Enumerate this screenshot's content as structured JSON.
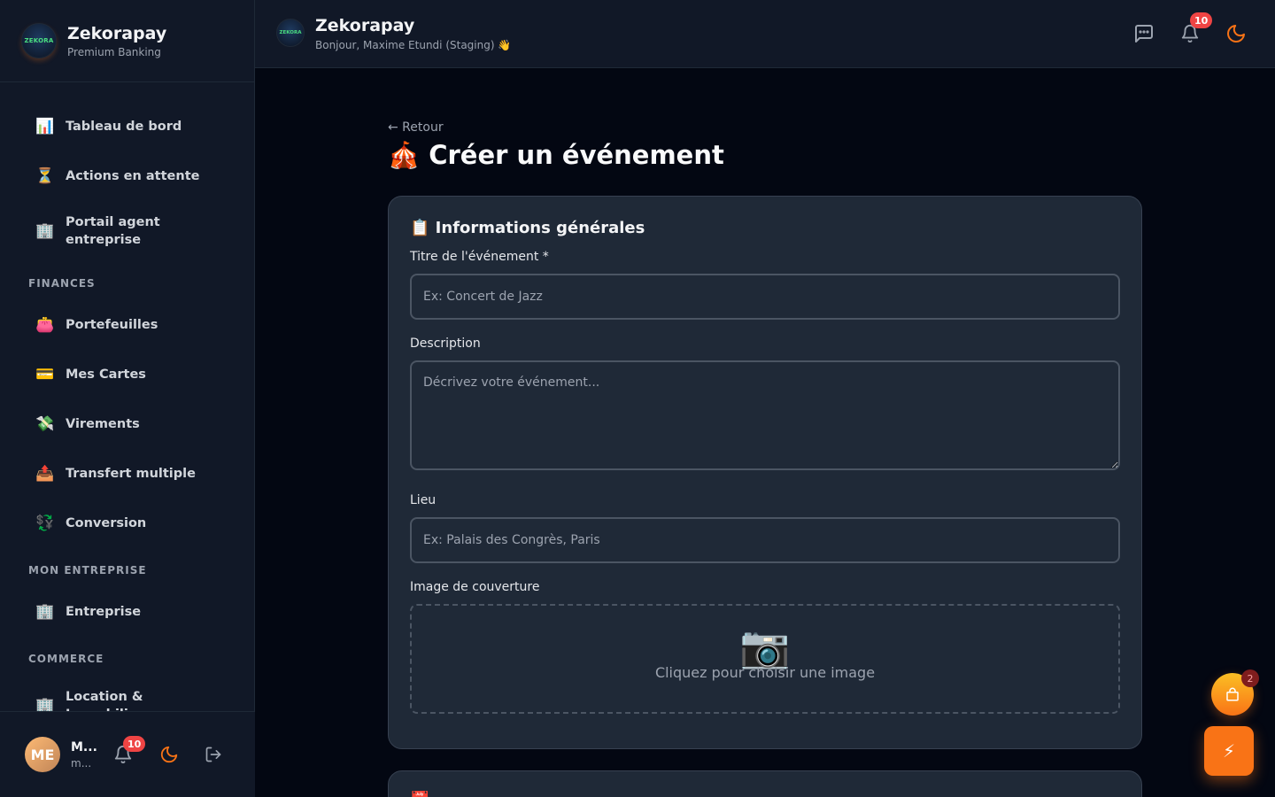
{
  "app": {
    "name": "Zekorapay",
    "subtitle": "Premium Banking",
    "logo_text": "ZEKORA"
  },
  "sidebar": {
    "items": [
      {
        "icon": "📊",
        "label": "Tableau de bord"
      },
      {
        "icon": "⏳",
        "label": "Actions en attente"
      },
      {
        "icon": "🏢",
        "label": "Portail agent entreprise"
      }
    ],
    "sections": [
      {
        "title": "FINANCES",
        "items": [
          {
            "icon": "👛",
            "label": "Portefeuilles"
          },
          {
            "icon": "💳",
            "label": "Mes Cartes"
          },
          {
            "icon": "💸",
            "label": "Virements"
          },
          {
            "icon": "📤",
            "label": "Transfert multiple"
          },
          {
            "icon": "💱",
            "label": "Conversion"
          }
        ]
      },
      {
        "title": "MON ENTREPRISE",
        "items": [
          {
            "icon": "🏢",
            "label": "Entreprise"
          }
        ]
      },
      {
        "title": "COMMERCE",
        "items": [
          {
            "icon": "🏢",
            "label": "Location & Immobilier"
          }
        ]
      }
    ]
  },
  "user": {
    "initials": "ME",
    "name": "M...",
    "email": "m...",
    "notification_count": "10"
  },
  "header": {
    "title": "Zekorapay",
    "greeting": "Bonjour, Maxime Etundi (Staging) 👋",
    "notification_count": "10"
  },
  "page": {
    "back_label": "← Retour",
    "title": "🎪 Créer un événement",
    "section_title": "📋 Informations générales",
    "fields": {
      "title_label": "Titre de l'événement *",
      "title_placeholder": "Ex: Concert de Jazz",
      "description_label": "Description",
      "description_placeholder": "Décrivez votre événement...",
      "location_label": "Lieu",
      "location_placeholder": "Ex: Palais des Congrès, Paris",
      "cover_label": "Image de couverture",
      "cover_icon": "📷",
      "cover_hint": "Cliquez pour choisir une image"
    },
    "next_section_icon": "📅"
  },
  "floating": {
    "cart_badge": "2",
    "action_icon": "⚡"
  },
  "colors": {
    "accent": "#f97316",
    "badge": "#ef4444",
    "sidebar_bg": "#111827",
    "card_bg": "#1f2937"
  }
}
